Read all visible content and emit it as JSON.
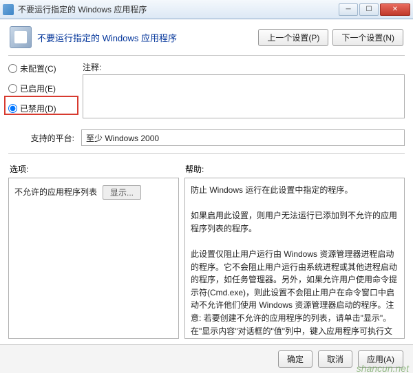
{
  "window": {
    "title": "不要运行指定的 Windows 应用程序"
  },
  "header": {
    "title": "不要运行指定的 Windows 应用程序",
    "prev": "上一个设置(P)",
    "next": "下一个设置(N)"
  },
  "radios": {
    "not_configured": "未配置(C)",
    "enabled": "已启用(E)",
    "disabled": "已禁用(D)"
  },
  "comment": {
    "label": "注释:"
  },
  "platform": {
    "label": "支持的平台:",
    "value": "至少 Windows 2000"
  },
  "panels": {
    "options_label": "选项:",
    "help_label": "帮助:",
    "disallowed_label": "不允许的应用程序列表",
    "show_btn": "显示...",
    "help_text": "防止 Windows 运行在此设置中指定的程序。\n\n如果启用此设置，则用户无法运行已添加到不允许的应用程序列表的程序。\n\n此设置仅阻止用户运行由 Windows 资源管理器进程启动的程序。它不会阻止用户运行由系统进程或其他进程启动的程序，如任务管理器。另外，如果允许用户使用命令提示符(Cmd.exe)，则此设置不会阻止用户在命令窗口中启动不允许他们使用 Windows 资源管理器启动的程序。注意: 若要创建不允许的应用程序的列表，请单击\"显示\"。在\"显示内容\"对话框的\"值\"列中，键入应用程序可执行文件名(例如，Winword.exe、Poledit.exe 和 Powerpnt.exe)。"
  },
  "footer": {
    "ok": "确定",
    "cancel": "取消",
    "apply": "应用(A)"
  },
  "watermark": "shancun.net"
}
